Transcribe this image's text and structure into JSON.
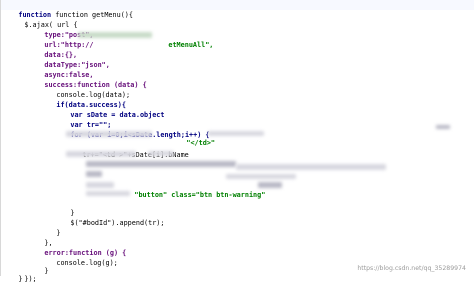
{
  "editor": {
    "lines": {
      "l1": "function getMenu(){",
      "l2a": "$.ajax( url {",
      "l3a": "type:\"post\",",
      "l4a": "url:\"http://",
      "l4b": "etMenuAll\",",
      "l5": "data:{},",
      "l6": "dataType:\"json\",",
      "l7": "async:false,",
      "l8": "success:function (data) {",
      "l9": "console.log(data);",
      "l10": "if(data.success){",
      "l11a": "var sDate = data.object",
      "l12": "var tr=\"\";",
      "l13": "for (var i=0;i<sDate.length;i++) {",
      "l13b": "\"</td>\"",
      "l15": "tr+=\"<td >\"+sDate[i].bName",
      "l21a": "\"button\" class=\"btn btn-warning\"",
      "l22": "}",
      "l23": "$(\"#bodId\").append(tr);",
      "l24": "}",
      "l25": "},",
      "l26": "error:function (g) {",
      "l27": "console.log(g);",
      "l28": "}",
      "l29": "});",
      "l30": "}"
    },
    "watermark": "https://blog.csdn.net/qq_35289974"
  }
}
